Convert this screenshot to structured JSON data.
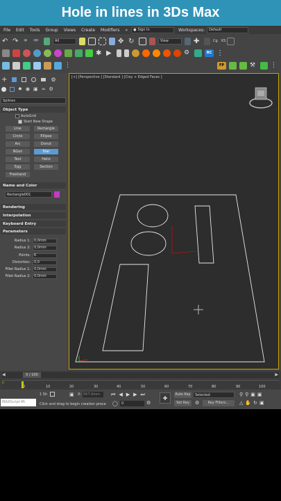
{
  "banner": {
    "title": "Hole in lines in 3Ds Max"
  },
  "menu": {
    "items": [
      "File",
      "Edit",
      "Tools",
      "Group",
      "Views",
      "Create",
      "Modifiers",
      "»"
    ],
    "signin": "Sign In",
    "workspaces_label": "Workspaces:",
    "workspaces_value": "Default"
  },
  "toolbar": {
    "filter_value": "All",
    "view_value": "View",
    "rc_label": "RC",
    "fp_label": "FP",
    "xs_label": "XS",
    "cg_label": "Cg"
  },
  "panel": {
    "dropdown": "Splines",
    "object_type": {
      "title": "Object Type",
      "autogrid": "AutoGrid",
      "start_new_shape": "Start New Shape",
      "buttons": [
        "Line",
        "Rectangle",
        "Circle",
        "Ellipse",
        "Arc",
        "Donut",
        "NGon",
        "Star",
        "Text",
        "Helix",
        "Egg",
        "Section",
        "Freehand"
      ],
      "active": "Star"
    },
    "name_color": {
      "title": "Name and Color",
      "name": "Rectangle001"
    },
    "rollouts": [
      "Rendering",
      "Interpolation",
      "Keyboard Entry",
      "Parameters"
    ],
    "params": [
      {
        "label": "Radius 1:",
        "value": "0,0mm"
      },
      {
        "label": "Radius 2:",
        "value": "0,0mm"
      },
      {
        "label": "Points:",
        "value": "6"
      },
      {
        "label": "Distortion:",
        "value": "0,0"
      },
      {
        "label": "Fillet Radius 1:",
        "value": "0,0mm"
      },
      {
        "label": "Fillet Radius 2:",
        "value": "0,0mm"
      }
    ]
  },
  "viewport": {
    "label": "[+] [Perspective ] [Standard ] [Clay + Edged Faces ]"
  },
  "timeline": {
    "frame": "0 / 100",
    "ticks": [
      "0",
      "10",
      "20",
      "30",
      "40",
      "50",
      "60",
      "70",
      "80",
      "90",
      "100"
    ]
  },
  "status": {
    "maxscript": "MAXScript Mi",
    "selected_count": "1 Sh",
    "prompt": "Click and drag to begin creation proce",
    "x_label": "X:",
    "x_value": "567,0mm",
    "auto_key": "Auto Key",
    "selected": "Selected",
    "set_key": "Set Key",
    "key_filters": "Key Filters...",
    "frame_value": "0"
  },
  "colors": {
    "accent": "#5b9bd5",
    "banner": "#2f93b8",
    "viewport_border": "#c9a200",
    "swatch": "#c33bc4"
  }
}
